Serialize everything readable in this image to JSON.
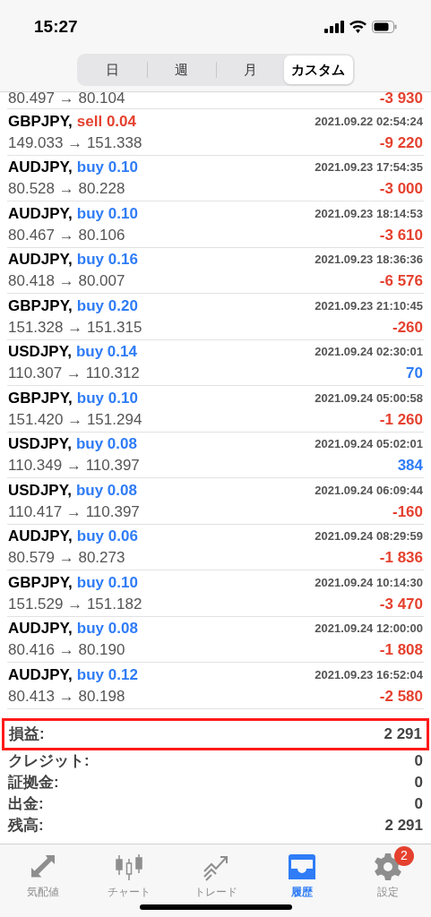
{
  "status_bar": {
    "time": "15:27"
  },
  "segments": [
    {
      "label": "日",
      "selected": false
    },
    {
      "label": "週",
      "selected": false
    },
    {
      "label": "月",
      "selected": false
    },
    {
      "label": "カスタム",
      "selected": true
    }
  ],
  "partial_row": {
    "prices": "80.497 → 80.104",
    "profit": {
      "text": "-3 930",
      "color": "#e5412f"
    }
  },
  "trades": [
    {
      "symbol": "GBPJPY,",
      "order": {
        "text": "sell 0.04",
        "color": "#e5412f"
      },
      "time": "2021.09.22 02:54:24",
      "prices": "149.033 → 151.338",
      "profit": {
        "text": "-9 220",
        "color": "#e5412f"
      }
    },
    {
      "symbol": "AUDJPY,",
      "order": {
        "text": "buy 0.10",
        "color": "#2f7cf6"
      },
      "time": "2021.09.23 17:54:35",
      "prices": "80.528 → 80.228",
      "profit": {
        "text": "-3 000",
        "color": "#e5412f"
      }
    },
    {
      "symbol": "AUDJPY,",
      "order": {
        "text": "buy 0.10",
        "color": "#2f7cf6"
      },
      "time": "2021.09.23 18:14:53",
      "prices": "80.467 → 80.106",
      "profit": {
        "text": "-3 610",
        "color": "#e5412f"
      }
    },
    {
      "symbol": "AUDJPY,",
      "order": {
        "text": "buy 0.16",
        "color": "#2f7cf6"
      },
      "time": "2021.09.23 18:36:36",
      "prices": "80.418 → 80.007",
      "profit": {
        "text": "-6 576",
        "color": "#e5412f"
      }
    },
    {
      "symbol": "GBPJPY,",
      "order": {
        "text": "buy 0.20",
        "color": "#2f7cf6"
      },
      "time": "2021.09.23 21:10:45",
      "prices": "151.328 → 151.315",
      "profit": {
        "text": "-260",
        "color": "#e5412f"
      }
    },
    {
      "symbol": "USDJPY,",
      "order": {
        "text": "buy 0.14",
        "color": "#2f7cf6"
      },
      "time": "2021.09.24 02:30:01",
      "prices": "110.307 → 110.312",
      "profit": {
        "text": "70",
        "color": "#2f7cf6"
      }
    },
    {
      "symbol": "GBPJPY,",
      "order": {
        "text": "buy 0.10",
        "color": "#2f7cf6"
      },
      "time": "2021.09.24 05:00:58",
      "prices": "151.420 → 151.294",
      "profit": {
        "text": "-1 260",
        "color": "#e5412f"
      }
    },
    {
      "symbol": "USDJPY,",
      "order": {
        "text": "buy 0.08",
        "color": "#2f7cf6"
      },
      "time": "2021.09.24 05:02:01",
      "prices": "110.349 → 110.397",
      "profit": {
        "text": "384",
        "color": "#2f7cf6"
      }
    },
    {
      "symbol": "USDJPY,",
      "order": {
        "text": "buy 0.08",
        "color": "#2f7cf6"
      },
      "time": "2021.09.24 06:09:44",
      "prices": "110.417 → 110.397",
      "profit": {
        "text": "-160",
        "color": "#e5412f"
      }
    },
    {
      "symbol": "AUDJPY,",
      "order": {
        "text": "buy 0.06",
        "color": "#2f7cf6"
      },
      "time": "2021.09.24 08:29:59",
      "prices": "80.579 → 80.273",
      "profit": {
        "text": "-1 836",
        "color": "#e5412f"
      }
    },
    {
      "symbol": "GBPJPY,",
      "order": {
        "text": "buy 0.10",
        "color": "#2f7cf6"
      },
      "time": "2021.09.24 10:14:30",
      "prices": "151.529 → 151.182",
      "profit": {
        "text": "-3 470",
        "color": "#e5412f"
      }
    },
    {
      "symbol": "AUDJPY,",
      "order": {
        "text": "buy 0.08",
        "color": "#2f7cf6"
      },
      "time": "2021.09.24 12:00:00",
      "prices": "80.416 → 80.190",
      "profit": {
        "text": "-1 808",
        "color": "#e5412f"
      }
    },
    {
      "symbol": "AUDJPY,",
      "order": {
        "text": "buy 0.12",
        "color": "#2f7cf6"
      },
      "time": "2021.09.23 16:52:04",
      "prices": "80.413 → 80.198",
      "profit": {
        "text": "-2 580",
        "color": "#e5412f"
      }
    }
  ],
  "summary": [
    {
      "label": "損益:",
      "value": "2 291",
      "highlighted": true
    },
    {
      "label": "クレジット:",
      "value": "0",
      "highlighted": false
    },
    {
      "label": "証拠金:",
      "value": "0",
      "highlighted": false
    },
    {
      "label": "出金:",
      "value": "0",
      "highlighted": false
    },
    {
      "label": "残高:",
      "value": "2 291",
      "highlighted": false
    }
  ],
  "tab_bar": [
    {
      "kind": "quotes",
      "label": "気配値",
      "selected": false
    },
    {
      "kind": "chart",
      "label": "チャート",
      "selected": false
    },
    {
      "kind": "trade",
      "label": "トレード",
      "selected": false
    },
    {
      "kind": "history",
      "label": "履歴",
      "selected": true
    },
    {
      "kind": "settings",
      "label": "設定",
      "selected": false,
      "badge": "2"
    }
  ]
}
